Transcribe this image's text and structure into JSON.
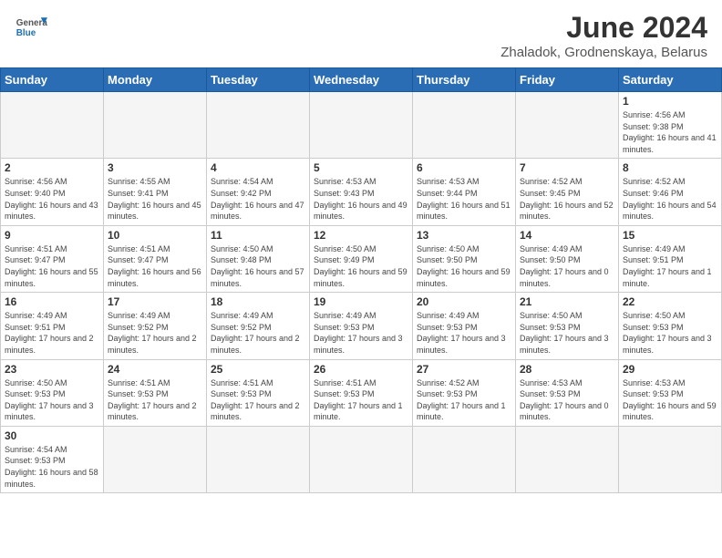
{
  "header": {
    "title": "June 2024",
    "subtitle": "Zhaladok, Grodnenskaya, Belarus",
    "logo_general": "General",
    "logo_blue": "Blue"
  },
  "weekdays": [
    "Sunday",
    "Monday",
    "Tuesday",
    "Wednesday",
    "Thursday",
    "Friday",
    "Saturday"
  ],
  "weeks": [
    [
      {
        "day": "",
        "empty": true
      },
      {
        "day": "",
        "empty": true
      },
      {
        "day": "",
        "empty": true
      },
      {
        "day": "",
        "empty": true
      },
      {
        "day": "",
        "empty": true
      },
      {
        "day": "",
        "empty": true
      },
      {
        "day": "1",
        "sunrise": "4:56 AM",
        "sunset": "9:38 PM",
        "daylight": "16 hours and 41 minutes."
      }
    ],
    [
      {
        "day": "2",
        "sunrise": "4:56 AM",
        "sunset": "9:40 PM",
        "daylight": "16 hours and 43 minutes."
      },
      {
        "day": "3",
        "sunrise": "4:55 AM",
        "sunset": "9:41 PM",
        "daylight": "16 hours and 45 minutes."
      },
      {
        "day": "4",
        "sunrise": "4:54 AM",
        "sunset": "9:42 PM",
        "daylight": "16 hours and 47 minutes."
      },
      {
        "day": "5",
        "sunrise": "4:53 AM",
        "sunset": "9:43 PM",
        "daylight": "16 hours and 49 minutes."
      },
      {
        "day": "6",
        "sunrise": "4:53 AM",
        "sunset": "9:44 PM",
        "daylight": "16 hours and 51 minutes."
      },
      {
        "day": "7",
        "sunrise": "4:52 AM",
        "sunset": "9:45 PM",
        "daylight": "16 hours and 52 minutes."
      },
      {
        "day": "8",
        "sunrise": "4:52 AM",
        "sunset": "9:46 PM",
        "daylight": "16 hours and 54 minutes."
      }
    ],
    [
      {
        "day": "9",
        "sunrise": "4:51 AM",
        "sunset": "9:47 PM",
        "daylight": "16 hours and 55 minutes."
      },
      {
        "day": "10",
        "sunrise": "4:51 AM",
        "sunset": "9:47 PM",
        "daylight": "16 hours and 56 minutes."
      },
      {
        "day": "11",
        "sunrise": "4:50 AM",
        "sunset": "9:48 PM",
        "daylight": "16 hours and 57 minutes."
      },
      {
        "day": "12",
        "sunrise": "4:50 AM",
        "sunset": "9:49 PM",
        "daylight": "16 hours and 59 minutes."
      },
      {
        "day": "13",
        "sunrise": "4:50 AM",
        "sunset": "9:50 PM",
        "daylight": "16 hours and 59 minutes."
      },
      {
        "day": "14",
        "sunrise": "4:49 AM",
        "sunset": "9:50 PM",
        "daylight": "17 hours and 0 minutes."
      },
      {
        "day": "15",
        "sunrise": "4:49 AM",
        "sunset": "9:51 PM",
        "daylight": "17 hours and 1 minute."
      }
    ],
    [
      {
        "day": "16",
        "sunrise": "4:49 AM",
        "sunset": "9:51 PM",
        "daylight": "17 hours and 2 minutes."
      },
      {
        "day": "17",
        "sunrise": "4:49 AM",
        "sunset": "9:52 PM",
        "daylight": "17 hours and 2 minutes."
      },
      {
        "day": "18",
        "sunrise": "4:49 AM",
        "sunset": "9:52 PM",
        "daylight": "17 hours and 2 minutes."
      },
      {
        "day": "19",
        "sunrise": "4:49 AM",
        "sunset": "9:53 PM",
        "daylight": "17 hours and 3 minutes."
      },
      {
        "day": "20",
        "sunrise": "4:49 AM",
        "sunset": "9:53 PM",
        "daylight": "17 hours and 3 minutes."
      },
      {
        "day": "21",
        "sunrise": "4:50 AM",
        "sunset": "9:53 PM",
        "daylight": "17 hours and 3 minutes."
      },
      {
        "day": "22",
        "sunrise": "4:50 AM",
        "sunset": "9:53 PM",
        "daylight": "17 hours and 3 minutes."
      }
    ],
    [
      {
        "day": "23",
        "sunrise": "4:50 AM",
        "sunset": "9:53 PM",
        "daylight": "17 hours and 3 minutes."
      },
      {
        "day": "24",
        "sunrise": "4:51 AM",
        "sunset": "9:53 PM",
        "daylight": "17 hours and 2 minutes."
      },
      {
        "day": "25",
        "sunrise": "4:51 AM",
        "sunset": "9:53 PM",
        "daylight": "17 hours and 2 minutes."
      },
      {
        "day": "26",
        "sunrise": "4:51 AM",
        "sunset": "9:53 PM",
        "daylight": "17 hours and 1 minute."
      },
      {
        "day": "27",
        "sunrise": "4:52 AM",
        "sunset": "9:53 PM",
        "daylight": "17 hours and 1 minute."
      },
      {
        "day": "28",
        "sunrise": "4:53 AM",
        "sunset": "9:53 PM",
        "daylight": "17 hours and 0 minutes."
      },
      {
        "day": "29",
        "sunrise": "4:53 AM",
        "sunset": "9:53 PM",
        "daylight": "16 hours and 59 minutes."
      }
    ],
    [
      {
        "day": "30",
        "sunrise": "4:54 AM",
        "sunset": "9:53 PM",
        "daylight": "16 hours and 58 minutes."
      },
      {
        "day": "",
        "empty": true
      },
      {
        "day": "",
        "empty": true
      },
      {
        "day": "",
        "empty": true
      },
      {
        "day": "",
        "empty": true
      },
      {
        "day": "",
        "empty": true
      },
      {
        "day": "",
        "empty": true
      }
    ]
  ]
}
